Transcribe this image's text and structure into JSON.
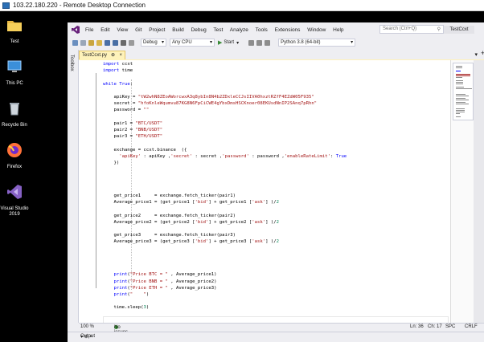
{
  "rdp": {
    "title": "103.22.180.220 - Remote Desktop Connection"
  },
  "desktop": {
    "icons": [
      {
        "label": "Test",
        "icon": "folder-icon"
      },
      {
        "label": "This PC",
        "icon": "computer-icon"
      },
      {
        "label": "Recycle Bin",
        "icon": "recycle-bin-icon"
      },
      {
        "label": "Firefox",
        "icon": "firefox-icon"
      },
      {
        "label": "Visual Studio",
        "label2": "2019",
        "icon": "visual-studio-icon"
      }
    ]
  },
  "vs": {
    "menu": [
      "File",
      "Edit",
      "View",
      "Git",
      "Project",
      "Build",
      "Debug",
      "Test",
      "Analyze",
      "Tools",
      "Extensions",
      "Window",
      "Help"
    ],
    "search_placeholder": "Search (Ctrl+Q)",
    "project_badge": "TestCcxt",
    "toolbar": {
      "config": "Debug",
      "platform": "Any CPU",
      "start": "Start",
      "env": "Python 3.8 (64-bit)"
    },
    "side_panel": "Toolbox",
    "tab": {
      "label": "TestCcxt.py",
      "pin": "⊕",
      "close": "×"
    },
    "status": {
      "zoom": "100 %",
      "issues": "No issues found",
      "ln": "Ln: 36",
      "ch": "Ch: 17",
      "encoding": "SPC",
      "eol": "CRLF"
    },
    "output_label": "Output",
    "output_controls": "▾ ⊕ ×"
  },
  "code": [
    "import ccxt",
    "import time",
    "",
    "while True:",
    "",
    "    apiKey = \"tW2whN8ZEoAWorcwxA3q8ybIn8N4b2ZDxleCCJsIIVA0hxztRZfF4EZdW05F935\"",
    "    secret = \"hfoKnleWqumvu87KG8N6FpCiCWE4gYbxDmsHSCKnoer08EKUsdNnIP2SAnq7pRhn\"",
    "    password = \"\"",
    "",
    "    pair1 = \"BTC/USDT\"",
    "    pair2 = \"BNB/USDT\"",
    "    pair3 = \"ETH/USDT\"",
    "",
    "    exchange = ccxt.binance  ({",
    "      'apiKey' : apiKey ,'secret' : secret ,'password' : password ,'enableRateLimit': True",
    "    })",
    "",
    "",
    "",
    "",
    "    get_price1     = exchange.fetch_ticker(pair1)",
    "    Average_price1 = (get_price1 ['bid'] + get_price1 ['ask'] )/2",
    "",
    "    get_price2     = exchange.fetch_ticker(pair2)",
    "    Average_price2 = (get_price2 ['bid'] + get_price2 ['ask'] )/2",
    "",
    "    get_price3     = exchange.fetch_ticker(pair3)",
    "    Average_price3 = (get_price3 ['bid'] + get_price3 ['ask'] )/2",
    "",
    "",
    "",
    "",
    "    print(\"Price BTC = \" , Average_price1)",
    "    print(\"Price BNB = \" , Average_price2)",
    "    print(\"Price ETH = \" , Average_price3)",
    "    print(\"    \")",
    "",
    "    time.sleep(3)"
  ],
  "colors": {
    "accent": "#68217a",
    "tab": "#fef2ba",
    "ok": "#388a34"
  }
}
